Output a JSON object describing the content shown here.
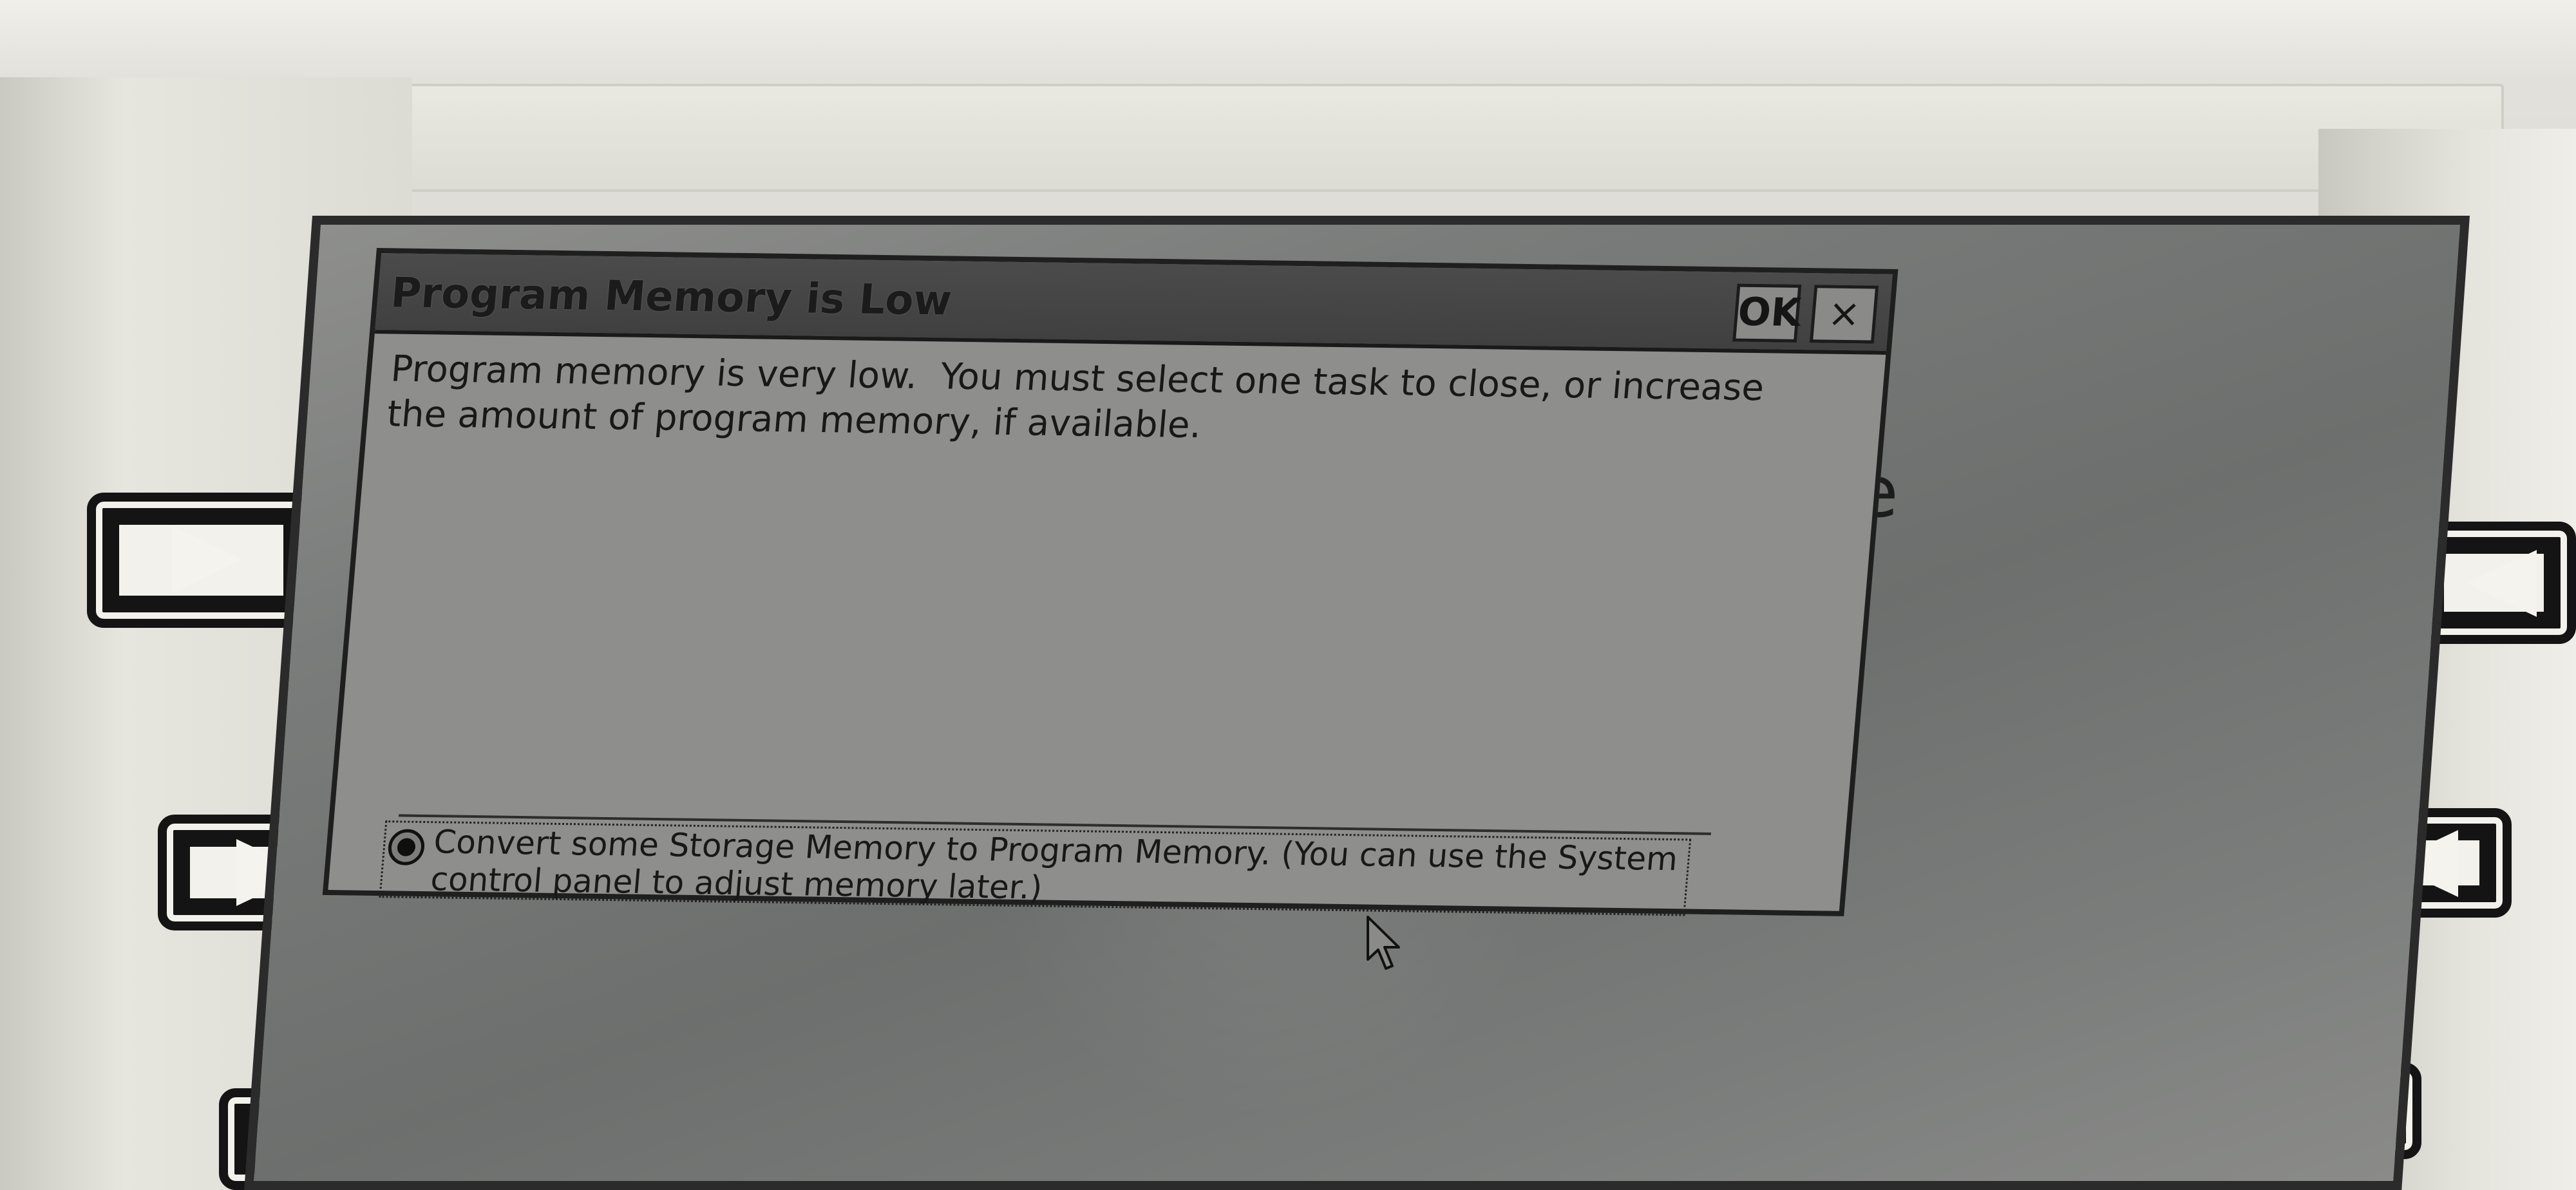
{
  "dialog": {
    "title": "Program Memory is Low",
    "ok_label": "OK",
    "close_label": "×",
    "message": "Program memory is very low.  You must select one task to close, or increase\nthe amount of program memory, if available.",
    "option": {
      "label": "Convert some Storage Memory to Program Memory.  (You can use the System control panel to adjust memory later.)",
      "selected": true
    }
  },
  "background": {
    "partial_text": "e"
  },
  "bezel": {
    "left_buttons": [
      "arrow-right",
      "arrow-right",
      "arrow-right"
    ],
    "right_buttons": [
      "arrow-left",
      "arrow-left",
      "arrow-left"
    ]
  },
  "icons": {
    "radio": "radio-selected-icon",
    "cursor": "mouse-pointer-icon"
  },
  "colors": {
    "screen_bg": "#7a7c7b",
    "dialog_bg": "#8e8f8d",
    "titlebar_bg": "#3f403f",
    "text": "#181818",
    "bezel": "#e6e5de"
  }
}
